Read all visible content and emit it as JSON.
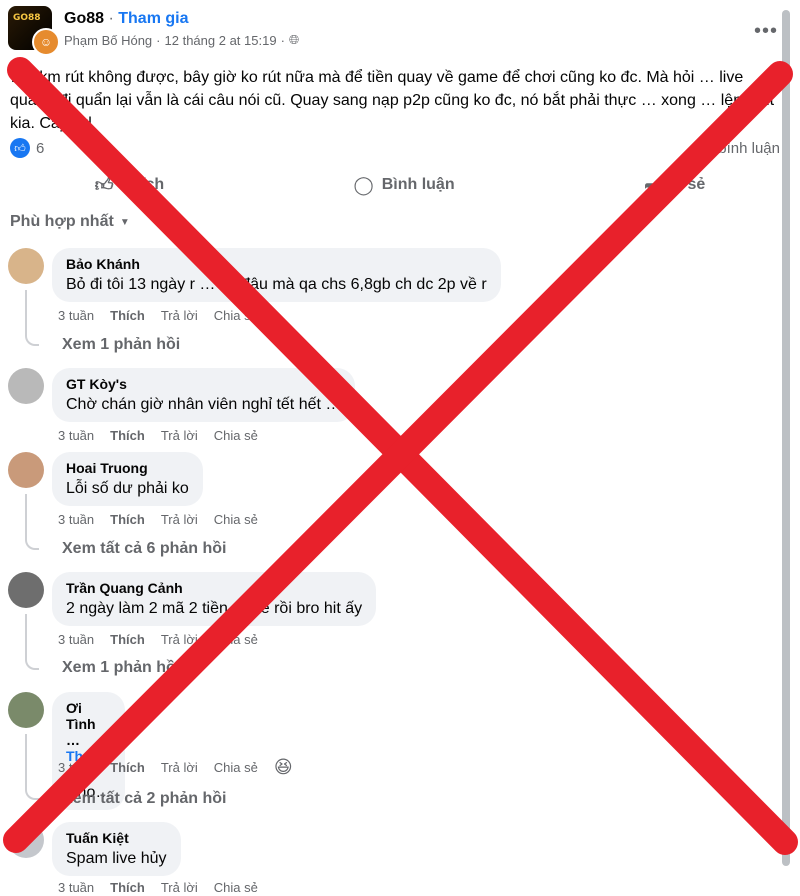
{
  "post": {
    "group_name": "Go88",
    "join_label": "Tham gia",
    "author": "Phạm Bố Hóng",
    "date": "12 tháng 2 at 15:19",
    "text": "… đkm rút không được, bây giờ ko rút nữa mà để tiền quay về game để chơi cũng ko đc. Mà hỏi … live quanh đi quẩn lại vẫn là cái câu nói cũ. Quay sang nạp p2p cũng ko đc, nó bắt phải thực … xong … lệnh rút kia. Cay vkl",
    "reaction_count": "6",
    "comment_count_label": "…bình luận"
  },
  "actions": {
    "like": "Thích",
    "comment": "Bình luận",
    "share": "… sẻ"
  },
  "sort_label": "Phù hợp nhất",
  "comments": [
    {
      "name": "Bảo Khánh",
      "text": "Bỏ đi tôi 13 ngày r … về đâu mà qa chs 6,8gb ch dc 2p về r",
      "time": "3 tuần",
      "like": "Thích",
      "reply": "Trả lời",
      "share": "Chia sẻ",
      "replies": "Xem 1 phản hồi"
    },
    {
      "name": "GT Kòy's",
      "text": "Chờ chán giờ nhân viên nghỉ tết hết …",
      "time": "3 tuần",
      "like": "Thích",
      "reply": "Trả lời",
      "share": "Chia sẻ"
    },
    {
      "name": "Hoai Truong",
      "text": "Lỗi số dư phải ko",
      "time": "3 tuần",
      "like": "Thích",
      "reply": "Trả lời",
      "share": "Chia sẻ",
      "replies": "Xem tất cả 6 phản hồi"
    },
    {
      "name": "Trần Quang Cảnh",
      "text": "2 ngày làm 2 mã 2 tiền … về rồi bro hit ấy",
      "time": "3 tuần",
      "like": "Thích",
      "reply": "Trả lời",
      "share": "Chia sẻ",
      "replies": "Xem 1 phản hồi"
    },
    {
      "name": "Ơi Tình …",
      "follow": "Theo dõi",
      "text": "Cho…",
      "time": "3 tuần",
      "like": "Thích",
      "reply": "Trả lời",
      "share": "Chia sẻ",
      "replies": "Xem tất cả 2 phản hồi"
    },
    {
      "name": "Tuấn Kiệt",
      "text": "Spam live hủy",
      "time": "3 tuần",
      "like": "Thích",
      "reply": "Trả lời",
      "share": "Chia sẻ"
    }
  ],
  "colors": {
    "cross": "#e8212b",
    "accent": "#1877f2",
    "muted": "#65676b",
    "bubble": "#f0f2f5"
  }
}
